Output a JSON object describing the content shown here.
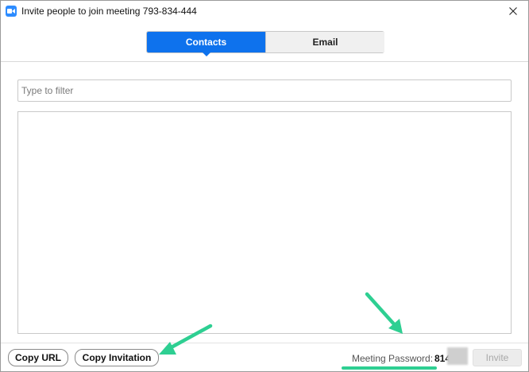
{
  "window": {
    "title": "Invite people to join meeting 793-834-444"
  },
  "tabs": [
    {
      "label": "Contacts",
      "active": true
    },
    {
      "label": "Email",
      "active": false
    }
  ],
  "filter": {
    "placeholder": "Type to filter",
    "value": ""
  },
  "contacts": [],
  "footer": {
    "copy_url_label": "Copy URL",
    "copy_invitation_label": "Copy Invitation",
    "password_label": "Meeting Password:",
    "password_visible_value": "814",
    "invite_label": "Invite",
    "invite_enabled": false
  },
  "annotations": {
    "arrow_color": "#2ecf92",
    "highlight_color": "#2ecf92"
  },
  "colors": {
    "accent": "#0E72ED",
    "app_icon": "#2D8CFF"
  }
}
